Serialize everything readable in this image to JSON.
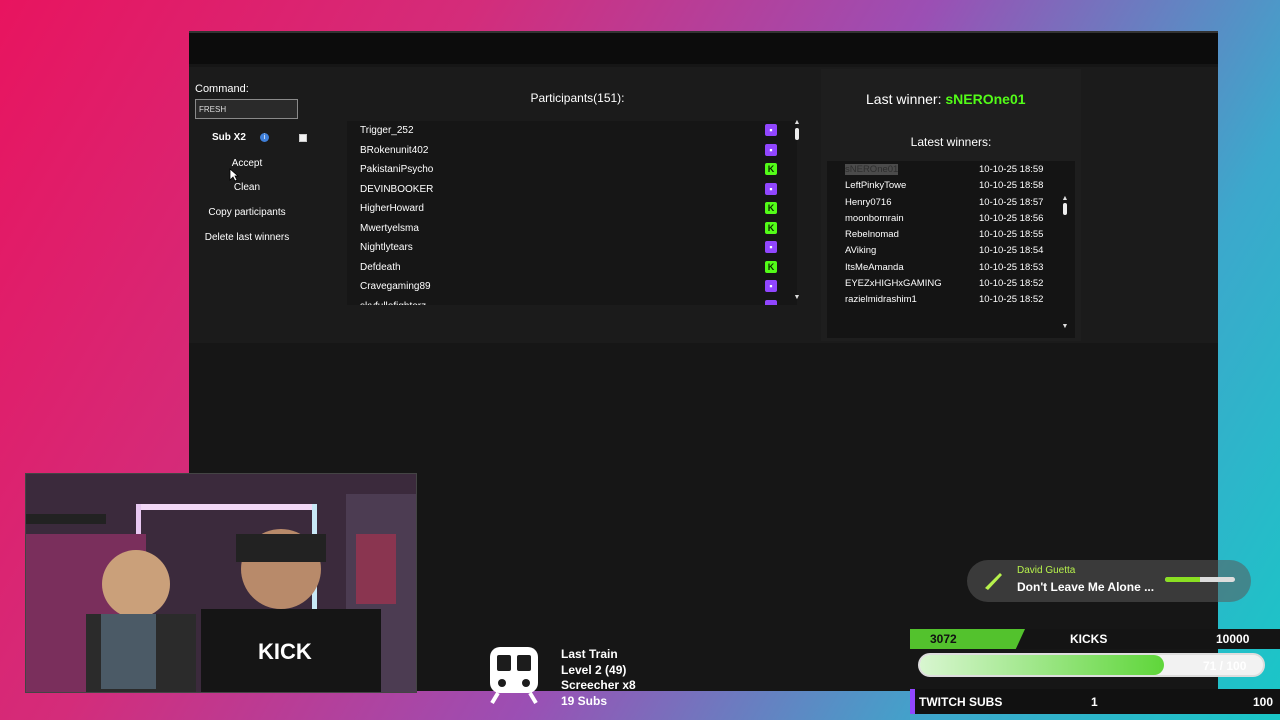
{
  "app": {
    "command_label": "Command:",
    "command_value": "FRESH",
    "sub_multiplier_label": "Sub X2",
    "info_icon": "info-icon",
    "buttons": {
      "accept": "Accept",
      "clean": "Clean",
      "copy": "Copy participants",
      "delete": "Delete last winners"
    },
    "participants_title": "Participants(151):",
    "participants": [
      {
        "name": "Trigger_252",
        "platform": "twitch"
      },
      {
        "name": "BRokenunit402",
        "platform": "twitch"
      },
      {
        "name": "PakistaniPsycho",
        "platform": "kick"
      },
      {
        "name": "DEVINBOOKER",
        "platform": "twitch"
      },
      {
        "name": "HigherHoward",
        "platform": "kick"
      },
      {
        "name": "Mwertyelsma",
        "platform": "kick"
      },
      {
        "name": "Nightlytears",
        "platform": "twitch"
      },
      {
        "name": "Defdeath",
        "platform": "kick"
      },
      {
        "name": "Cravegaming89",
        "platform": "twitch"
      },
      {
        "name": "skyfullofighterz",
        "platform": "twitch"
      }
    ],
    "last_winner_label": "Last winner:",
    "last_winner_name": "sNEROne01",
    "latest_winners_title": "Latest winners:",
    "winners": [
      {
        "name": "sNEROne01",
        "time": "10-10-25 18:59"
      },
      {
        "name": "LeftPinkyTowe",
        "time": "10-10-25 18:58"
      },
      {
        "name": "Henry0716",
        "time": "10-10-25 18:57"
      },
      {
        "name": "moonbornrain",
        "time": "10-10-25 18:56"
      },
      {
        "name": "Rebelnomad",
        "time": "10-10-25 18:55"
      },
      {
        "name": "AViking",
        "time": "10-10-25 18:54"
      },
      {
        "name": "ItsMeAmanda",
        "time": "10-10-25 18:53"
      },
      {
        "name": "EYEZxHIGHxGAMING",
        "time": "10-10-25 18:52"
      },
      {
        "name": "razielmidrashim1",
        "time": "10-10-25 18:52"
      }
    ]
  },
  "now_playing": {
    "artist": "David Guetta",
    "title": "Don't Leave Me Alone ..."
  },
  "train": {
    "title": "Last Train",
    "level": "Level 2  (49)",
    "top": "Screecher x8",
    "subs": "19 Subs"
  },
  "goals": {
    "kicks_start": "3072",
    "kicks_label": "KICKS",
    "kicks_end": "10000",
    "kicks_progress_text": "71 / 100",
    "kicks_progress_value": 0.71,
    "twitch_label": "TWITCH SUBS",
    "twitch_current": "1",
    "twitch_end": "100"
  },
  "colors": {
    "kick_green": "#53fc18",
    "twitch_purple": "#9146ff",
    "panel": "#1b1b1b"
  }
}
